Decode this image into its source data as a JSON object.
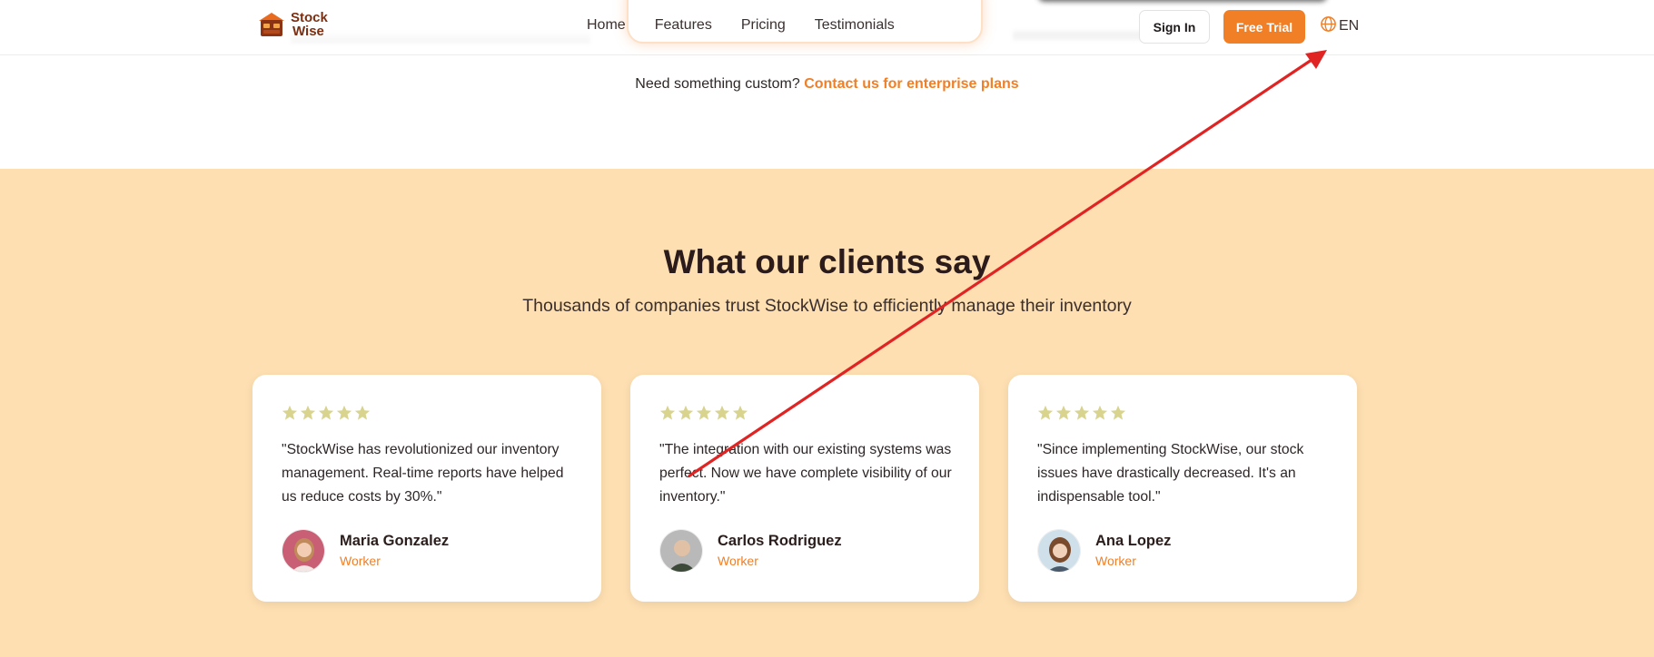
{
  "header": {
    "logo_line1": "Stock",
    "logo_line2": "Wise",
    "nav": [
      "Home",
      "Features",
      "Pricing",
      "Testimonials"
    ],
    "signin_label": "Sign In",
    "trial_label": "Free Trial",
    "lang_label": "EN"
  },
  "custom": {
    "prefix": "Need something custom?",
    "link": "Contact us for enterprise plans"
  },
  "testimonials": {
    "title": "What our clients say",
    "subtitle": "Thousands of companies trust StockWise to efficiently manage their inventory",
    "cards": [
      {
        "rating": 5,
        "quote": "\"StockWise has revolutionized our inventory management. Real-time reports have helped us reduce costs by 30%.\"",
        "name": "Maria Gonzalez",
        "role": "Worker"
      },
      {
        "rating": 5,
        "quote": "\"The integration with our existing systems was perfect. Now we have complete visibility of our inventory.\"",
        "name": "Carlos Rodriguez",
        "role": "Worker"
      },
      {
        "rating": 5,
        "quote": "\"Since implementing StockWise, our stock issues have drastically decreased. It's an indispensable tool.\"",
        "name": "Ana Lopez",
        "role": "Worker"
      }
    ]
  },
  "colors": {
    "accent": "#f07f25",
    "section_bg": "#fddfb1",
    "star": "#d8d48d",
    "annotation_arrow": "#e02424"
  },
  "icons": {
    "language": "globe-icon",
    "rating": "star-icon",
    "annotation": "red-arrow"
  }
}
